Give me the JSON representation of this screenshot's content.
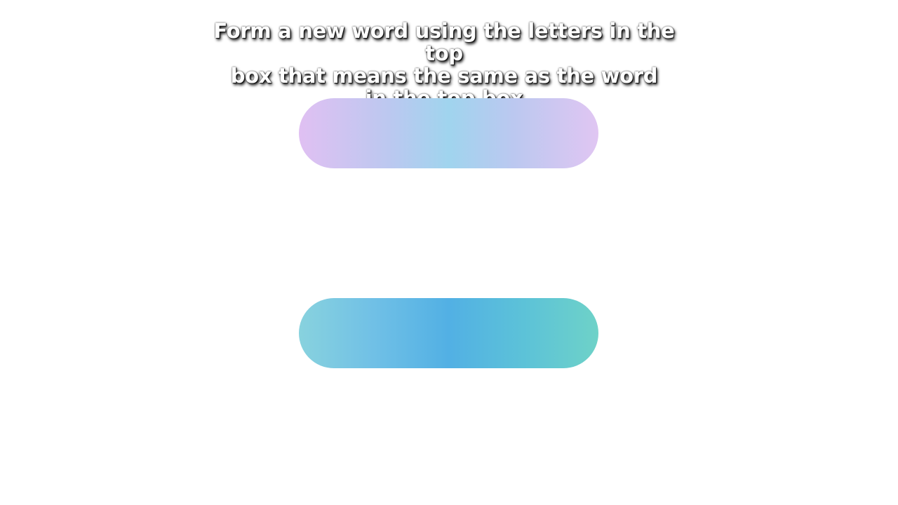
{
  "instruction": {
    "line1": "Form a new word using the letters in the top",
    "line2": "box that means the same as the word",
    "line3": "in the top box"
  },
  "top_box": {
    "word": "",
    "gradient_colors": [
      "#e0c0f2",
      "#a0d4ee",
      "#e0c6f2"
    ]
  },
  "answer_box": {
    "word": "",
    "gradient_colors": [
      "#88d2de",
      "#52b0e4",
      "#6ed2c8"
    ]
  }
}
